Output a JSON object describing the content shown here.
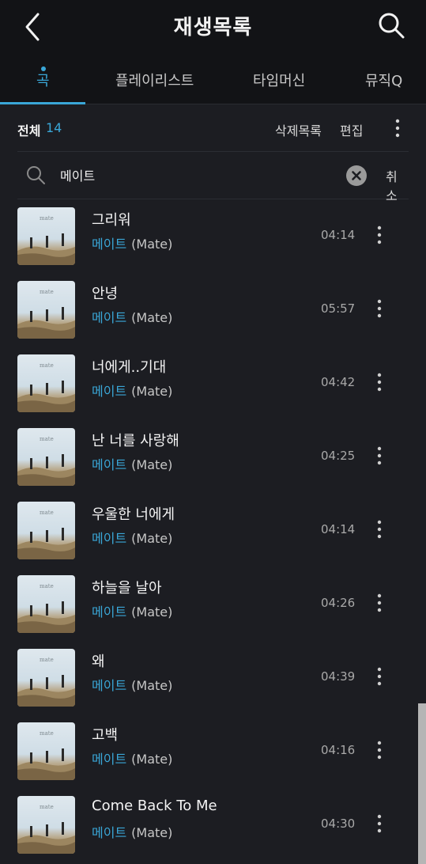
{
  "header": {
    "title": "재생목록"
  },
  "tabs": [
    {
      "label": "곡",
      "active": true
    },
    {
      "label": "플레이리스트",
      "active": false
    },
    {
      "label": "타임머신",
      "active": false
    },
    {
      "label": "뮤직Q",
      "active": false
    }
  ],
  "toolbar": {
    "count_label": "전체",
    "count_value": "14",
    "delete_list_label": "삭제목록",
    "edit_label": "편집"
  },
  "search": {
    "value": "메이트",
    "cancel_label": "취소"
  },
  "album_art": {
    "text": "mate"
  },
  "songs": [
    {
      "title": "그리워",
      "artist_ko": "메이트",
      "artist_en": "(Mate)",
      "duration": "04:14"
    },
    {
      "title": "안녕",
      "artist_ko": "메이트",
      "artist_en": "(Mate)",
      "duration": "05:57"
    },
    {
      "title": "너에게..기대",
      "artist_ko": "메이트",
      "artist_en": "(Mate)",
      "duration": "04:42"
    },
    {
      "title": "난 너를 사랑해",
      "artist_ko": "메이트",
      "artist_en": "(Mate)",
      "duration": "04:25"
    },
    {
      "title": "우울한 너에게",
      "artist_ko": "메이트",
      "artist_en": "(Mate)",
      "duration": "04:14"
    },
    {
      "title": "하늘을 날아",
      "artist_ko": "메이트",
      "artist_en": "(Mate)",
      "duration": "04:26"
    },
    {
      "title": "왜",
      "artist_ko": "메이트",
      "artist_en": "(Mate)",
      "duration": "04:39"
    },
    {
      "title": "고백",
      "artist_ko": "메이트",
      "artist_en": "(Mate)",
      "duration": "04:16"
    },
    {
      "title": "Come Back To Me",
      "artist_ko": "메이트",
      "artist_en": "(Mate)",
      "duration": "04:30"
    }
  ],
  "colors": {
    "accent": "#3aa7d8",
    "background": "#1c1d22",
    "header_bg": "#121316"
  },
  "icons": [
    "back-arrow-icon",
    "search-icon",
    "more-vertical-icon",
    "clear-icon"
  ]
}
